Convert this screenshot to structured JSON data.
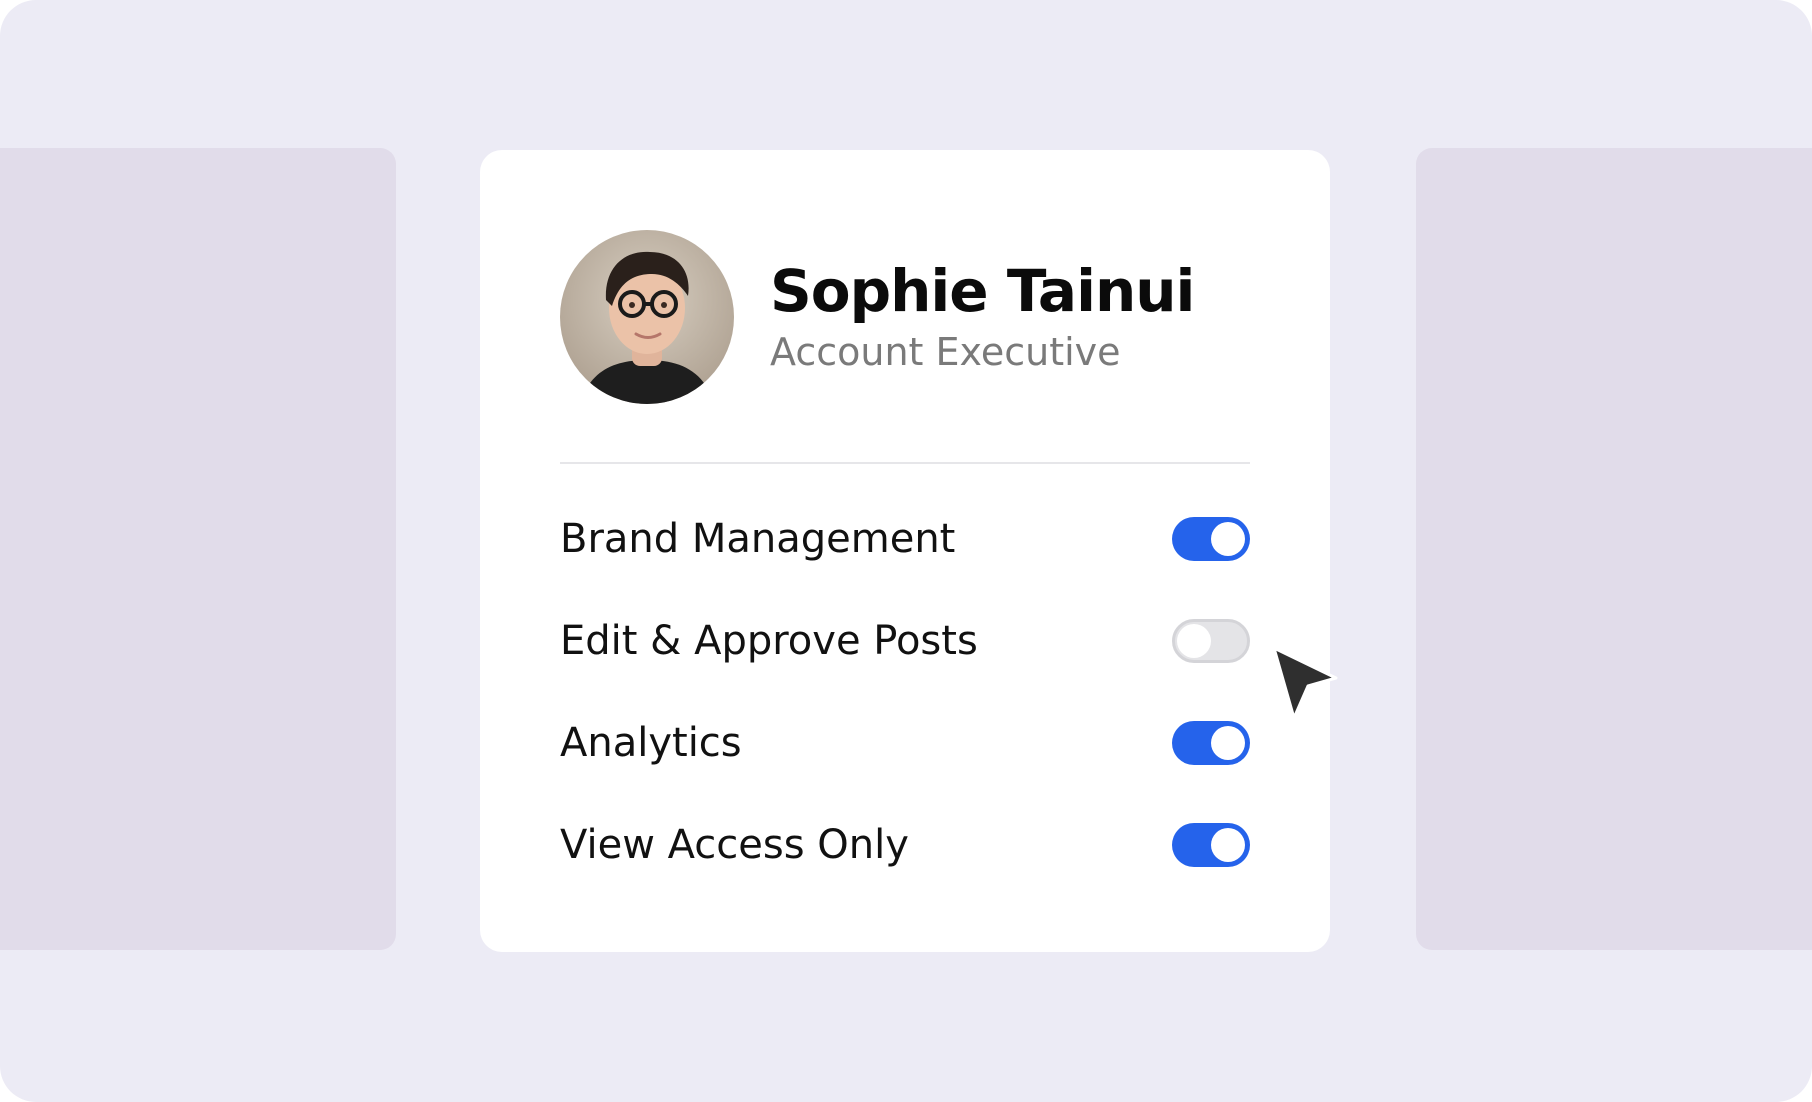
{
  "profile": {
    "name": "Sophie Tainui",
    "role": "Account Executive",
    "avatar_icon": "profile-photo"
  },
  "permissions": [
    {
      "label": "Brand Management",
      "enabled": true
    },
    {
      "label": "Edit & Approve Posts",
      "enabled": false
    },
    {
      "label": "Analytics",
      "enabled": true
    },
    {
      "label": "View Access Only",
      "enabled": true
    }
  ],
  "colors": {
    "background": "#ecebf5",
    "side_panel": "#e1dcea",
    "card": "#ffffff",
    "toggle_on": "#2563eb",
    "toggle_off": "#e4e4e7",
    "cursor": "#2f2f2f"
  },
  "cursor_icon": "mouse-pointer-icon"
}
